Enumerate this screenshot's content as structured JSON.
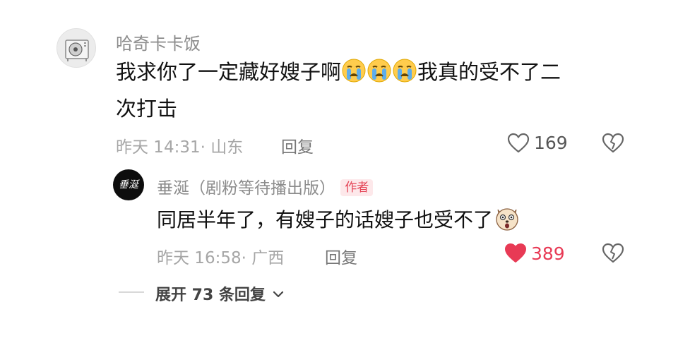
{
  "comment": {
    "username": "哈奇卡卡饭",
    "text_line1_a": "我求你了一定藏好嫂子啊",
    "text_line1_b": "我真的受不了二",
    "text_line2": "次打击",
    "emojis": [
      "crying-face",
      "crying-face",
      "crying-face"
    ],
    "meta": "昨天 14:31· 山东",
    "reply_label": "回复",
    "like_count": "169",
    "liked": false
  },
  "reply": {
    "username": "垂涎（剧粉等待播出版）",
    "author_badge": "作者",
    "avatar_text": "垂涎",
    "text": "同居半年了，有嫂子的话嫂子也受不了",
    "emoji": "shocked-dog",
    "meta": "昨天 16:58· 广西",
    "reply_label": "回复",
    "like_count": "389",
    "liked": true
  },
  "expand": {
    "label": "展开 73 条回复"
  },
  "colors": {
    "accent_red": "#e83a55",
    "badge_bg": "#fde8ea",
    "muted_text": "#a6a6a6"
  }
}
